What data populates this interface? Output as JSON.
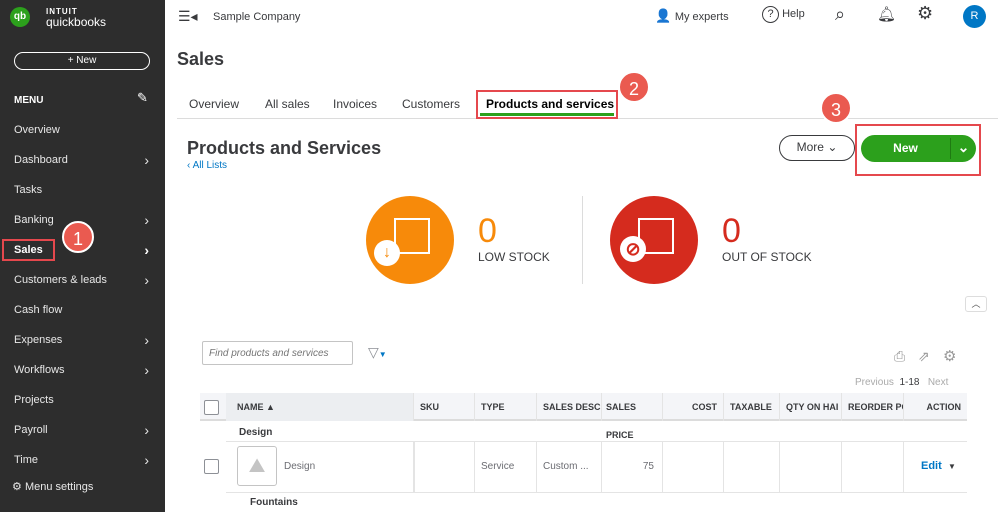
{
  "brand": {
    "logo": "qb",
    "line1": "INTUIT",
    "line2": "quickbooks"
  },
  "sidebar": {
    "new_label": "+ New",
    "menu_label": "MENU",
    "items": [
      {
        "label": "Overview",
        "chevron": false
      },
      {
        "label": "Dashboard",
        "chevron": true
      },
      {
        "label": "Tasks",
        "chevron": false
      },
      {
        "label": "Banking",
        "chevron": true
      },
      {
        "label": "Sales",
        "chevron": true,
        "active": true
      },
      {
        "label": "Customers & leads",
        "chevron": true
      },
      {
        "label": "Cash flow",
        "chevron": false
      },
      {
        "label": "Expenses",
        "chevron": true
      },
      {
        "label": "Workflows",
        "chevron": true
      },
      {
        "label": "Projects",
        "chevron": false
      },
      {
        "label": "Payroll",
        "chevron": true
      },
      {
        "label": "Time",
        "chevron": true
      }
    ],
    "settings_label": "Menu settings"
  },
  "topbar": {
    "company": "Sample Company",
    "experts": "My experts",
    "help": "Help",
    "avatar": "R"
  },
  "page": {
    "title": "Sales",
    "tabs": [
      "Overview",
      "All sales",
      "Invoices",
      "Customers",
      "Products and services"
    ],
    "active_tab": "Products and services"
  },
  "section": {
    "title": "Products and Services",
    "back_link": "All Lists",
    "more_label": "More",
    "new_label": "New"
  },
  "stock": {
    "low": {
      "count": "0",
      "label": "LOW STOCK"
    },
    "out": {
      "count": "0",
      "label": "OUT OF STOCK"
    }
  },
  "callouts": [
    "1",
    "2",
    "3"
  ],
  "table": {
    "search_placeholder": "Find products and services",
    "pagination": {
      "prev": "Previous",
      "range": "1-18",
      "next": "Next"
    },
    "columns": [
      "NAME ▲",
      "SKU",
      "TYPE",
      "SALES DESCI",
      "SALES PRICE",
      "COST",
      "TAXABLE",
      "QTY ON HAI",
      "REORDER PC",
      "ACTION"
    ],
    "groups": [
      {
        "name": "Design",
        "rows": [
          {
            "name": "Design",
            "sku": "",
            "type": "Service",
            "desc": "Custom ...",
            "price": "75",
            "action": "Edit"
          }
        ]
      },
      {
        "name": "Fountains",
        "rows": []
      }
    ]
  },
  "colors": {
    "accent": "#2ca01c",
    "sidebar": "#2d2d2d",
    "callout": "#ea5a50",
    "low": "#f78a0a",
    "out": "#d52b1e"
  }
}
